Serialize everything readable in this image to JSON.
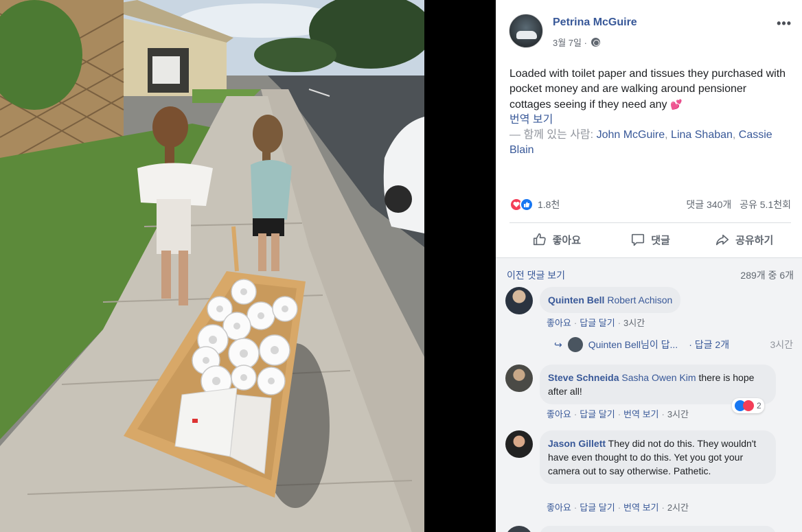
{
  "post": {
    "author": "Petrina McGuire",
    "date": "3월 7일 ·",
    "more": "•••",
    "text": "Loaded with toilet paper and tissues they purchased with pocket money and are walking around pensioner cottages seeing if they need any",
    "emoji": "💕",
    "translate": "번역 보기",
    "with_prefix": "— 함께 있는 사람:",
    "with_names": [
      "John McGuire",
      "Lina Shaban",
      "Cassie Blain"
    ],
    "reaction_count": "1.8천",
    "comments_count": "댓글 340개",
    "shares_count": "공유 5.1천회",
    "reactions": [
      "love-icon",
      "like-icon"
    ]
  },
  "actions": {
    "like": "좋아요",
    "comment": "댓글",
    "share": "공유하기"
  },
  "comments_section": {
    "prev_label": "이전 댓글 보기",
    "count_label": "289개 중 6개",
    "comments": [
      {
        "name": "Quinten Bell",
        "tag": "Robert Achison",
        "text": "",
        "like": "좋아요",
        "reply": "답글 달기",
        "translate": "",
        "time": "3시간"
      },
      {
        "name": "Steve Schneida",
        "tag": "Sasha Owen Kim",
        "text": "there is hope after all!",
        "like": "좋아요",
        "reply": "답글 달기",
        "translate": "번역 보기",
        "time": "3시간",
        "reaction_count": "2"
      },
      {
        "name": "Jason Gillett",
        "tag": "",
        "text": "They did not do this. They wouldn't have even thought to do this. Yet you got your camera out to say otherwise. Pathetic.",
        "like": "좋아요",
        "reply": "답글 달기",
        "translate": "번역 보기",
        "time": "2시간"
      }
    ],
    "reply_thread": {
      "text": "Quinten Bell님이 답...",
      "reply_count": "· 답글 2개",
      "time": "3시간"
    }
  }
}
